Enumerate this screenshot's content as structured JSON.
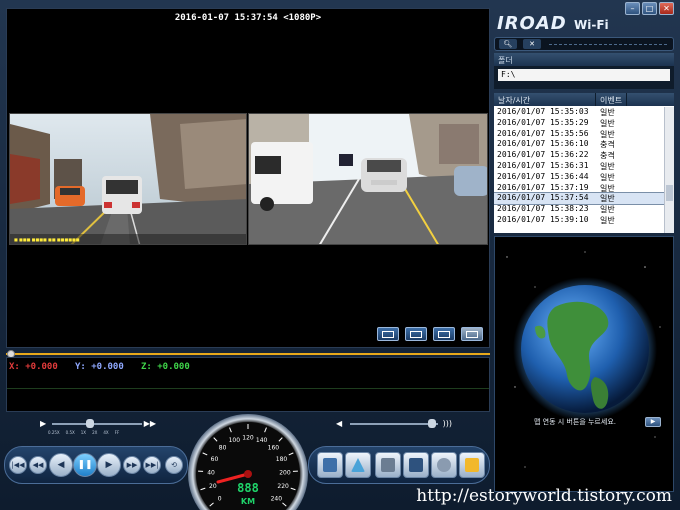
{
  "video": {
    "timestamp": "2016-01-07 15:37:54 <1080P>"
  },
  "gsensor": {
    "x": "X: +0.000",
    "y": "Y: +0.000",
    "z": "Z: +0.000"
  },
  "playback_speed": {
    "options": [
      "0.25X",
      "0.5X",
      "1X",
      "2X",
      "4X",
      "FF"
    ]
  },
  "speedometer": {
    "ticks": [
      "0",
      "20",
      "40",
      "60",
      "80",
      "100",
      "120",
      "140",
      "160",
      "180",
      "200",
      "220",
      "240"
    ],
    "digital": "888",
    "unit": "KM"
  },
  "app": {
    "logo": "IROAD",
    "logo_suffix": "Wi-Fi"
  },
  "folder": {
    "header": "폴더",
    "path": "F:\\"
  },
  "event_list": {
    "columns": [
      "날자/시간",
      "이벤트"
    ],
    "rows": [
      {
        "datetime": "2016/01/07 15:35:03",
        "event": "일반"
      },
      {
        "datetime": "2016/01/07 15:35:29",
        "event": "일반"
      },
      {
        "datetime": "2016/01/07 15:35:56",
        "event": "일반"
      },
      {
        "datetime": "2016/01/07 15:36:10",
        "event": "충격"
      },
      {
        "datetime": "2016/01/07 15:36:22",
        "event": "충격"
      },
      {
        "datetime": "2016/01/07 15:36:31",
        "event": "일반"
      },
      {
        "datetime": "2016/01/07 15:36:44",
        "event": "일반"
      },
      {
        "datetime": "2016/01/07 15:37:19",
        "event": "일반"
      },
      {
        "datetime": "2016/01/07 15:37:54",
        "event": "일반"
      },
      {
        "datetime": "2016/01/07 15:38:23",
        "event": "일반"
      },
      {
        "datetime": "2016/01/07 15:39:10",
        "event": "일반"
      }
    ],
    "selected_index": 8
  },
  "map": {
    "message": "맵 연동 시 버튼을 누르세요."
  },
  "watermark": "http://estoryworld.tistory.com",
  "colors": {
    "accent": "#e8a91b",
    "gx": "#e23b3b",
    "gy": "#8fa8ff",
    "gz": "#3fd54a"
  }
}
